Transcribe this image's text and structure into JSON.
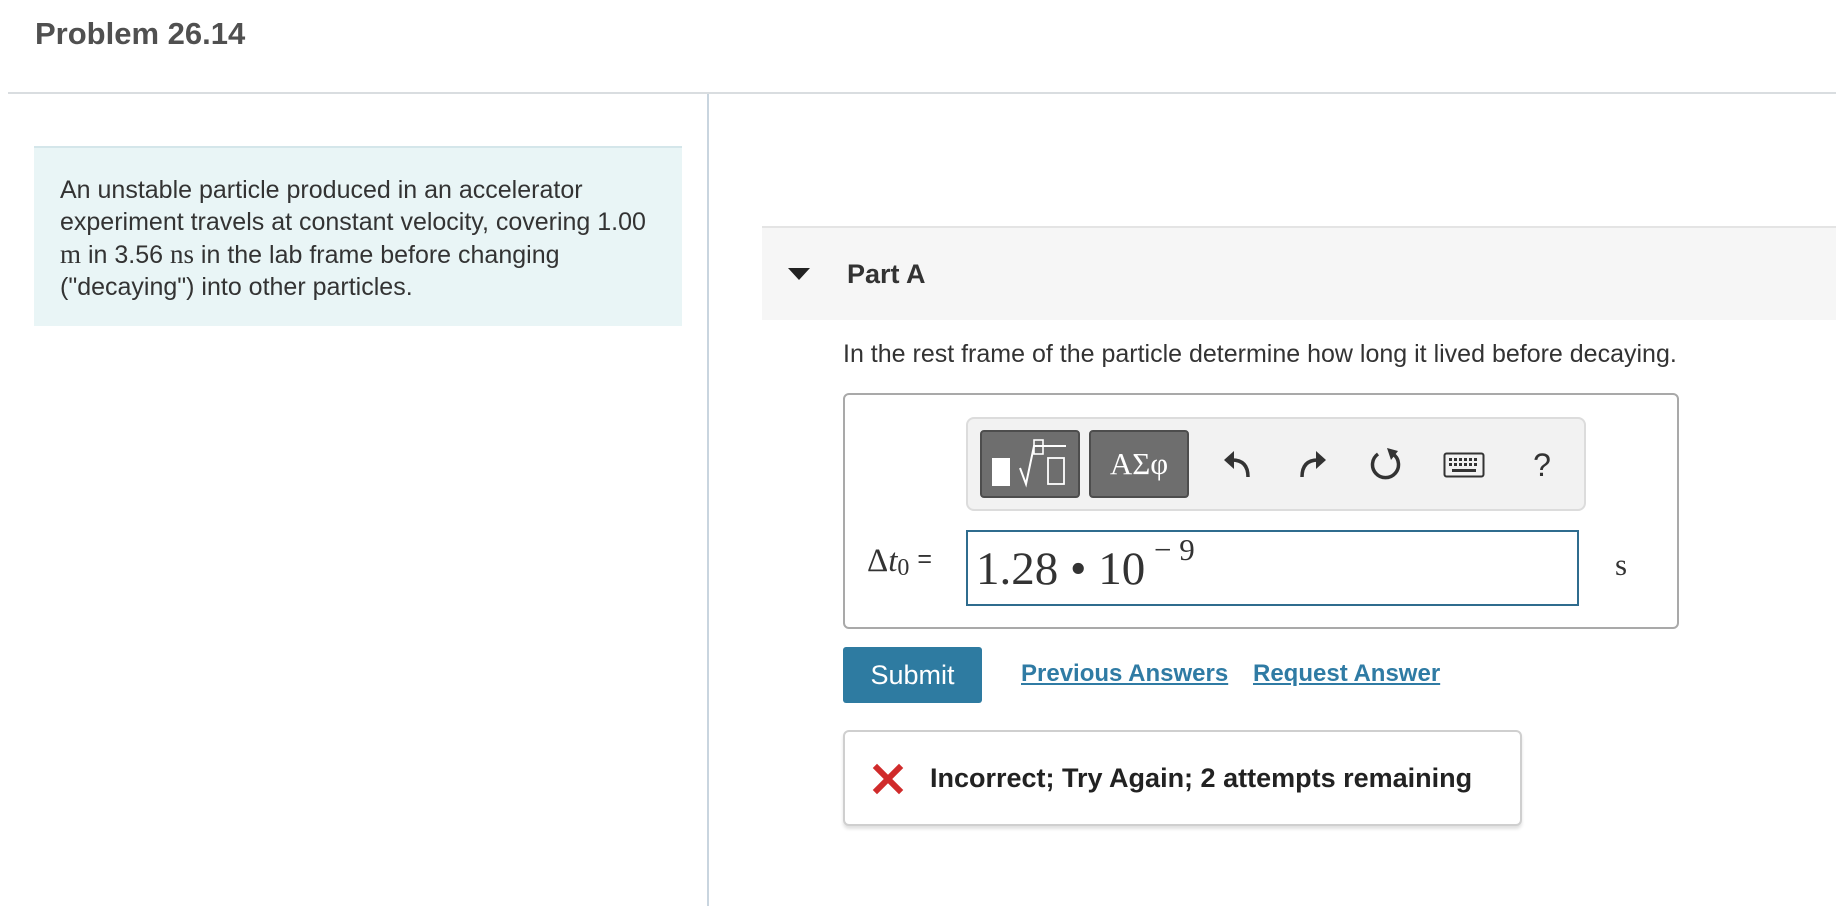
{
  "page": {
    "title": "Problem 26.14"
  },
  "problem": {
    "text_1": "An unstable particle produced in an accelerator experiment travels at constant velocity, covering 1.00 ",
    "unit_m": "m",
    "text_2": " in 3.56 ",
    "unit_ns": "ns",
    "text_3": " in the lab frame before changing (\"decaying\") into other particles."
  },
  "part_a": {
    "title": "Part A",
    "question": "In the rest frame of the particle determine how long it lived before decaying."
  },
  "toolbar": {
    "greek_label": "ΑΣφ",
    "help_label": "?",
    "icons": [
      "templates-icon",
      "undo-icon",
      "redo-icon",
      "reset-icon",
      "keyboard-icon",
      "help-icon"
    ]
  },
  "answer": {
    "label_delta": "Δ",
    "label_var": "t",
    "label_sub": "0",
    "label_eq": "=",
    "value_mantissa": "1.28 • 10",
    "value_exponent": "− 9",
    "unit": "s"
  },
  "actions": {
    "submit_label": "Submit",
    "previous_answers_label": "Previous Answers",
    "request_answer_label": "Request Answer"
  },
  "feedback": {
    "message": "Incorrect; Try Again; 2 attempts remaining",
    "status_color": "#d02b2b"
  },
  "colors": {
    "accent": "#2e7ba1",
    "link": "#2f7ba4",
    "problem_bg": "#e9f5f6"
  }
}
